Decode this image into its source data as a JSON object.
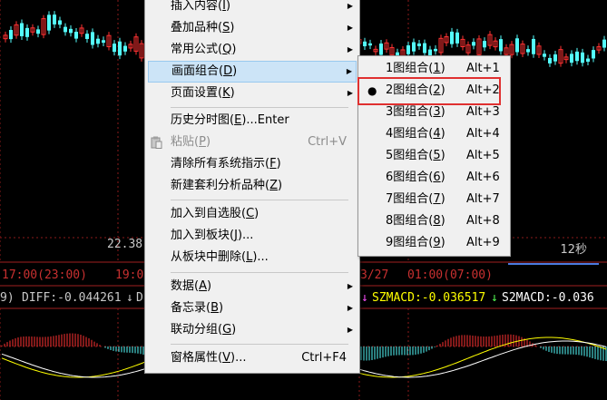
{
  "chart": {
    "price_label": "22.38",
    "timer_label": "12秒",
    "time_axis": [
      "17:00(23:00)",
      "19:0",
      "3/27",
      "01:00(07:00)"
    ],
    "indicator": {
      "prefix": "9) ",
      "diff": "DIFF:-0.044261",
      "diff_arrow": "↓",
      "trail": "D",
      "szmacd_arrow": "↓",
      "szmacd": "SZMACD:-0.036517",
      "s2macd_arrow": "↓",
      "s2macd": "S2MACD:-0.036"
    },
    "colors": {
      "up": "#ff3232",
      "down": "#54fcfc",
      "diff": "#c8c8c8",
      "szmacd": "#ffff00",
      "s2macd": "#ffffff",
      "grid": "#8b1a1a"
    }
  },
  "context_menu": {
    "items": [
      {
        "label": "插入内容",
        "key": "I",
        "submenu": true
      },
      {
        "label": "叠加品种",
        "key": "S",
        "submenu": true
      },
      {
        "label": "常用公式",
        "key": "Q",
        "submenu": true
      },
      {
        "label": "画面组合",
        "key": "D",
        "submenu": true,
        "highlighted": true
      },
      {
        "label": "页面设置",
        "key": "K",
        "submenu": true
      },
      {
        "label": "历史分时图",
        "key": "E",
        "suffix": "...Enter"
      },
      {
        "label": "粘贴",
        "key": "P",
        "shortcut": "Ctrl+V",
        "disabled": true,
        "icon": "paste-icon"
      },
      {
        "label": "清除所有系统指示",
        "key": "F"
      },
      {
        "label": "新建套利分析品种",
        "key": "Z"
      },
      {
        "label": "加入到自选股",
        "key": "C"
      },
      {
        "label": "加入到板块",
        "key": "J",
        "suffix": "..."
      },
      {
        "label": "从板块中删除",
        "key": "L",
        "suffix": "..."
      },
      {
        "label": "数据",
        "key": "A",
        "submenu": true
      },
      {
        "label": "备忘录",
        "key": "B",
        "submenu": true
      },
      {
        "label": "联动分组",
        "key": "G",
        "submenu": true
      },
      {
        "label": "窗格属性",
        "key": "V",
        "suffix": "...",
        "shortcut": "Ctrl+F4"
      }
    ]
  },
  "submenu": {
    "selected_index": 1,
    "items": [
      {
        "label": "1图组合",
        "key": "1",
        "shortcut": "Alt+1"
      },
      {
        "label": "2图组合",
        "key": "2",
        "shortcut": "Alt+2"
      },
      {
        "label": "3图组合",
        "key": "3",
        "shortcut": "Alt+3"
      },
      {
        "label": "4图组合",
        "key": "4",
        "shortcut": "Alt+4"
      },
      {
        "label": "5图组合",
        "key": "5",
        "shortcut": "Alt+5"
      },
      {
        "label": "6图组合",
        "key": "6",
        "shortcut": "Alt+6"
      },
      {
        "label": "7图组合",
        "key": "7",
        "shortcut": "Alt+7"
      },
      {
        "label": "8图组合",
        "key": "8",
        "shortcut": "Alt+8"
      },
      {
        "label": "9图组合",
        "key": "9",
        "shortcut": "Alt+9"
      }
    ]
  }
}
